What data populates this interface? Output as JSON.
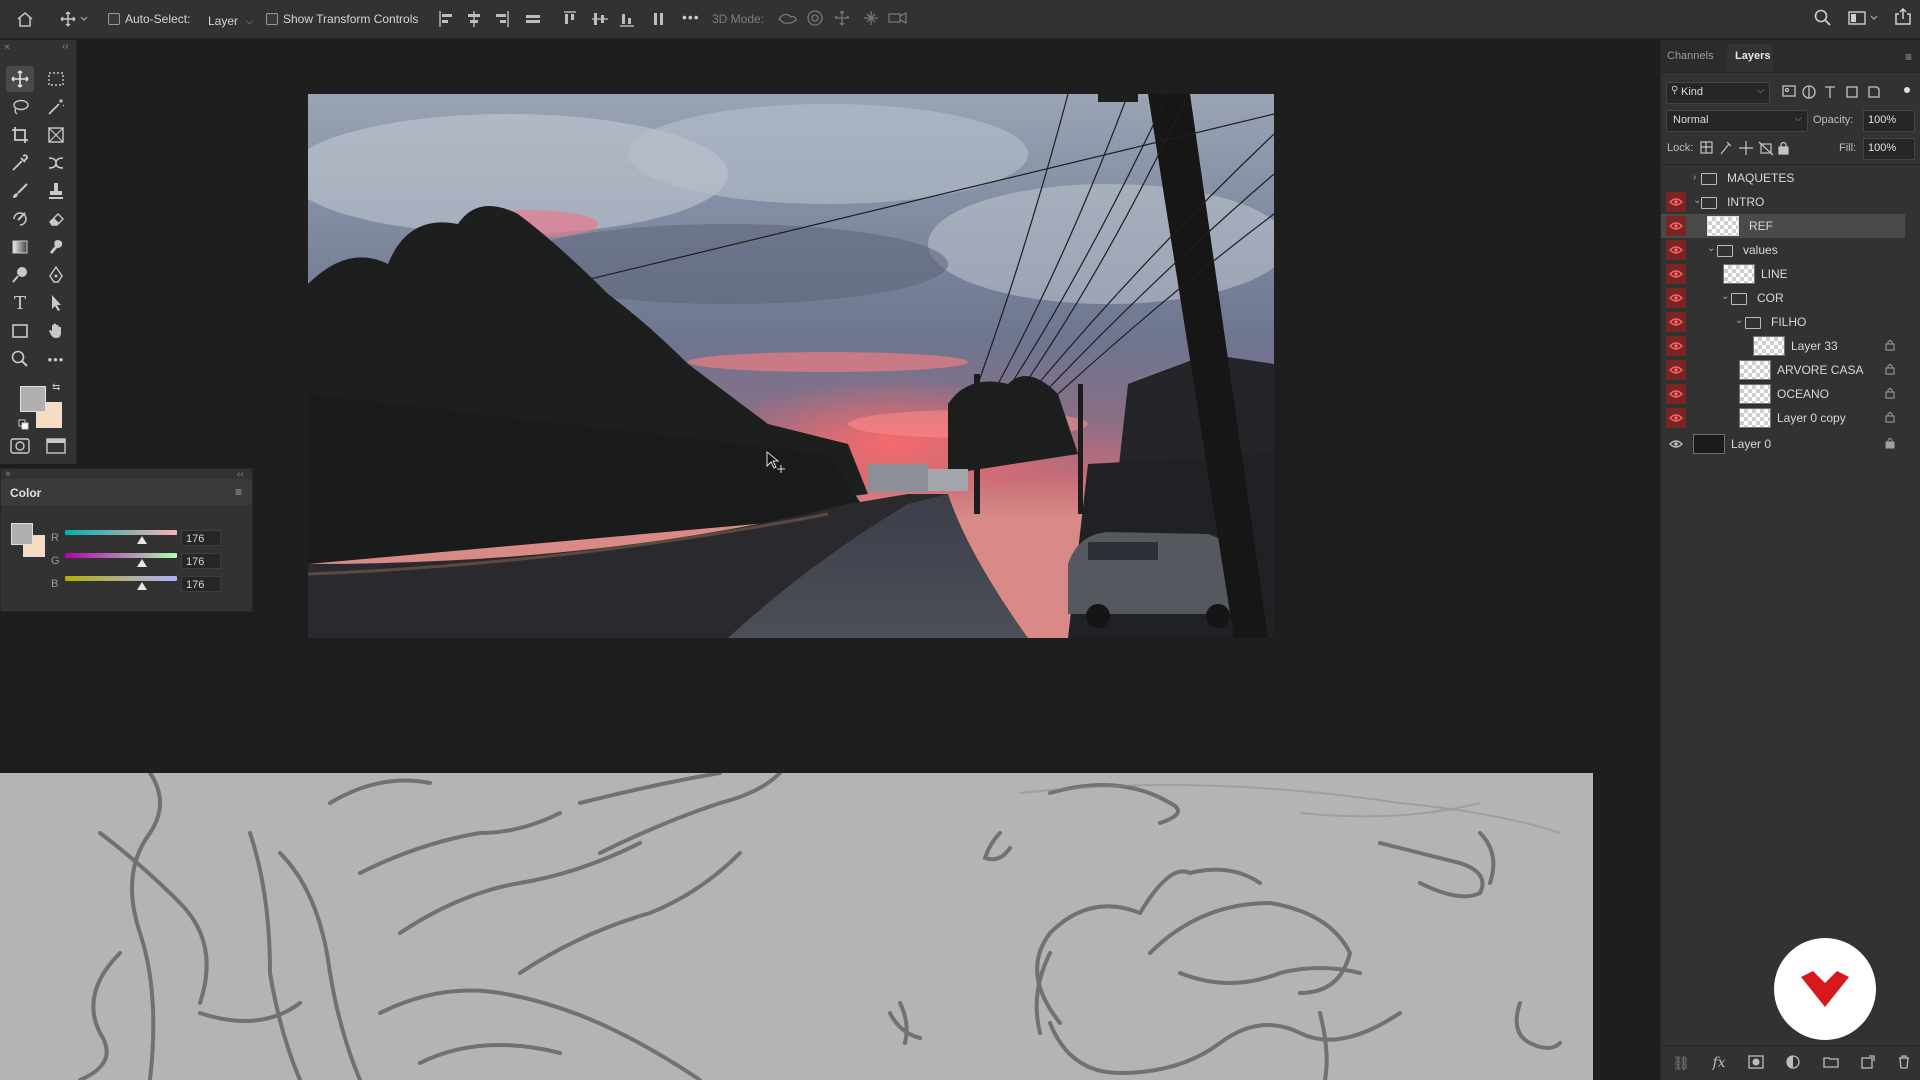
{
  "options_bar": {
    "auto_select_label": "Auto-Select:",
    "auto_select_target": "Layer",
    "show_transform_label": "Show Transform Controls",
    "mode_3d_label": "3D Mode:",
    "more_icon": "•••"
  },
  "toolbox": {
    "tools": [
      "move-tool",
      "marquee-tool",
      "lasso-tool",
      "magic-wand-tool",
      "crop-tool",
      "frame-tool",
      "eyedropper-tool",
      "patch-tool",
      "brush-tool",
      "stamp-tool",
      "history-brush-tool",
      "eraser-tool",
      "gradient-tool",
      "smudge-tool",
      "dodge-tool",
      "pen-tool",
      "type-tool",
      "path-selection-tool",
      "rectangle-tool",
      "hand-tool",
      "zoom-tool",
      "more-tools"
    ]
  },
  "color_panel": {
    "title": "Color",
    "channels": [
      {
        "label": "R",
        "value": "176",
        "level": 0.69
      },
      {
        "label": "G",
        "value": "176",
        "level": 0.69
      },
      {
        "label": "B",
        "value": "176",
        "level": 0.69
      }
    ],
    "foreground": "#b0b0b0",
    "background": "#f6dcc0"
  },
  "layers_panel": {
    "tabs": [
      "Channels",
      "Layers"
    ],
    "active_tab": "Layers",
    "filter_label": "Kind",
    "blend_mode": "Normal",
    "opacity_label": "Opacity:",
    "opacity_value": "100%",
    "lock_label": "Lock:",
    "fill_label": "Fill:",
    "fill_value": "100%",
    "layers": [
      {
        "name": "MAQUETES",
        "kind": "group",
        "visible": false,
        "expanded": false
      },
      {
        "name": "INTRO",
        "kind": "group",
        "visible": true,
        "expanded": true
      },
      {
        "name": "REF",
        "kind": "layer",
        "visible": true,
        "selected": true
      },
      {
        "name": "values",
        "kind": "group",
        "visible": true,
        "expanded": true
      },
      {
        "name": "LINE",
        "kind": "layer",
        "visible": true
      },
      {
        "name": "COR",
        "kind": "group",
        "visible": true,
        "expanded": true
      },
      {
        "name": "FILHO",
        "kind": "group",
        "visible": true,
        "expanded": true
      },
      {
        "name": "Layer 33",
        "kind": "layer",
        "visible": true,
        "locked": true
      },
      {
        "name": "ARVORE CASA",
        "kind": "layer",
        "visible": true,
        "locked": true
      },
      {
        "name": "OCEANO",
        "kind": "layer",
        "visible": true,
        "locked": true
      },
      {
        "name": "Layer 0 copy",
        "kind": "layer",
        "visible": true,
        "locked": true
      },
      {
        "name": "Layer 0",
        "kind": "layer",
        "visible": true,
        "locked": true
      }
    ]
  },
  "colors": {
    "accent_red": "#d7191f",
    "panel_bg": "#323232",
    "canvas_bg": "#1e1e1e"
  }
}
